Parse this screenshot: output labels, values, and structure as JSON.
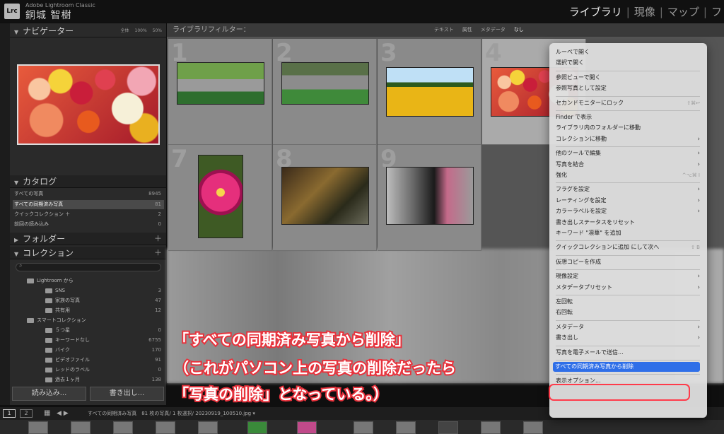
{
  "topbar": {
    "logo": "Lrc",
    "app_name": "Adobe Lightroom Classic",
    "user_name": "銅城 智樹",
    "modules": [
      {
        "label": "ライブラリ",
        "active": true
      },
      {
        "label": "現像",
        "active": false
      },
      {
        "label": "マップ",
        "active": false
      },
      {
        "label": "フ",
        "active": false
      }
    ]
  },
  "navigator": {
    "title": "ナビゲーター",
    "zoom": [
      "全体",
      "100%",
      "50%"
    ]
  },
  "catalog": {
    "title": "カタログ",
    "rows": [
      {
        "label": "すべての写真",
        "count": "8945",
        "selected": false
      },
      {
        "label": "すべての同期済み写真",
        "count": "81",
        "selected": true
      },
      {
        "label": "クイックコレクション ＋",
        "count": "2",
        "selected": false
      },
      {
        "label": "前回の読み込み",
        "count": "0",
        "selected": false
      }
    ]
  },
  "folders": {
    "title": "フォルダー"
  },
  "collections": {
    "title": "コレクション",
    "items": [
      {
        "label": "Lightroom から",
        "count": "",
        "indent": 1,
        "type": "set"
      },
      {
        "label": "SNS",
        "count": "3",
        "indent": 2,
        "type": "coll"
      },
      {
        "label": "家族の写真",
        "count": "47",
        "indent": 2,
        "type": "coll"
      },
      {
        "label": "共有用",
        "count": "12",
        "indent": 2,
        "type": "coll"
      },
      {
        "label": "スマートコレクション",
        "count": "",
        "indent": 1,
        "type": "set"
      },
      {
        "label": "５つ星",
        "count": "0",
        "indent": 2,
        "type": "smart"
      },
      {
        "label": "キーワードなし",
        "count": "6755",
        "indent": 2,
        "type": "smart"
      },
      {
        "label": "バイク",
        "count": "170",
        "indent": 2,
        "type": "smart"
      },
      {
        "label": "ビデオファイル",
        "count": "91",
        "indent": 2,
        "type": "smart"
      },
      {
        "label": "レッドのラベル",
        "count": "0",
        "indent": 2,
        "type": "smart"
      },
      {
        "label": "過去１ヶ月",
        "count": "138",
        "indent": 2,
        "type": "smart"
      }
    ]
  },
  "buttons": {
    "import": "読み込み...",
    "export": "書き出し..."
  },
  "filterbar": {
    "title": "ライブラリフィルター：",
    "tabs": [
      {
        "label": "テキスト",
        "on": false
      },
      {
        "label": "属性",
        "on": false
      },
      {
        "label": "メタデータ",
        "on": false
      },
      {
        "label": "なし",
        "on": true
      }
    ]
  },
  "grid": {
    "cells": [
      {
        "num": "1",
        "thumb": "moto1"
      },
      {
        "num": "2",
        "thumb": "moto2"
      },
      {
        "num": "3",
        "thumb": "sunf"
      },
      {
        "num": "4",
        "thumb": "flowers"
      },
      {
        "num": "7",
        "thumb": "dahlia"
      },
      {
        "num": "8",
        "thumb": "car"
      },
      {
        "num": "9",
        "thumb": "bike2"
      }
    ]
  },
  "statusbar": {
    "page1": "1",
    "page2": "2",
    "source": "すべての同期済み写真　81 枚の写真/ 1 枚選択/ 20230919_100510.jpg ▾"
  },
  "context_menu": {
    "items": [
      {
        "label": "ルーペで開く",
        "shortcut": "",
        "submenu": false
      },
      {
        "label": "選択で開く",
        "shortcut": "",
        "submenu": false
      },
      {
        "sep": true
      },
      {
        "label": "参照ビューで開く",
        "shortcut": "",
        "submenu": false
      },
      {
        "label": "参照写真として設定",
        "shortcut": "",
        "submenu": false
      },
      {
        "sep": true
      },
      {
        "label": "セカンドモニターにロック",
        "shortcut": "⇧⌘↩",
        "submenu": false
      },
      {
        "sep": true
      },
      {
        "label": "Finder で表示",
        "shortcut": "",
        "submenu": false
      },
      {
        "label": "ライブラリ内のフォルダーに移動",
        "shortcut": "",
        "submenu": false
      },
      {
        "label": "コレクションに移動",
        "shortcut": "",
        "submenu": true
      },
      {
        "sep": true
      },
      {
        "label": "他のツールで編集",
        "shortcut": "",
        "submenu": true
      },
      {
        "label": "写真を結合",
        "shortcut": "",
        "submenu": true
      },
      {
        "label": "強化",
        "shortcut": "^⌥⌘ I",
        "submenu": false
      },
      {
        "sep": true
      },
      {
        "label": "フラグを設定",
        "shortcut": "",
        "submenu": true
      },
      {
        "label": "レーティングを設定",
        "shortcut": "",
        "submenu": true
      },
      {
        "label": "カラーラベルを設定",
        "shortcut": "",
        "submenu": true
      },
      {
        "label": "書き出しステータスをリセット",
        "shortcut": "",
        "submenu": false
      },
      {
        "label": "キーワード \"凛華\" を追加",
        "shortcut": "",
        "submenu": false
      },
      {
        "sep": true
      },
      {
        "label": "クイックコレクションに追加 にして次へ",
        "shortcut": "⇧ B",
        "submenu": false
      },
      {
        "sep": true
      },
      {
        "label": "仮想コピーを作成",
        "shortcut": "",
        "submenu": false
      },
      {
        "sep": true
      },
      {
        "label": "現像設定",
        "shortcut": "",
        "submenu": true
      },
      {
        "label": "メタデータプリセット",
        "shortcut": "",
        "submenu": true
      },
      {
        "sep": true
      },
      {
        "label": "左回転",
        "shortcut": "",
        "submenu": false
      },
      {
        "label": "右回転",
        "shortcut": "",
        "submenu": false
      },
      {
        "sep": true
      },
      {
        "label": "メタデータ",
        "shortcut": "",
        "submenu": true
      },
      {
        "label": "書き出し",
        "shortcut": "",
        "submenu": true
      },
      {
        "sep": true
      },
      {
        "label": "写真を電子メールで送信...",
        "shortcut": "",
        "submenu": false
      },
      {
        "sep": true
      },
      {
        "label": "すべての同期済み写真から削除",
        "shortcut": "",
        "submenu": false,
        "highlight": true
      },
      {
        "sep": true
      },
      {
        "label": "表示オプション...",
        "shortcut": "",
        "submenu": false
      }
    ]
  },
  "captions": [
    "「すべての同期済み写真から削除」",
    "（これがパソコン上の写真の削除だったら",
    "「写真の削除」となっている。）"
  ]
}
